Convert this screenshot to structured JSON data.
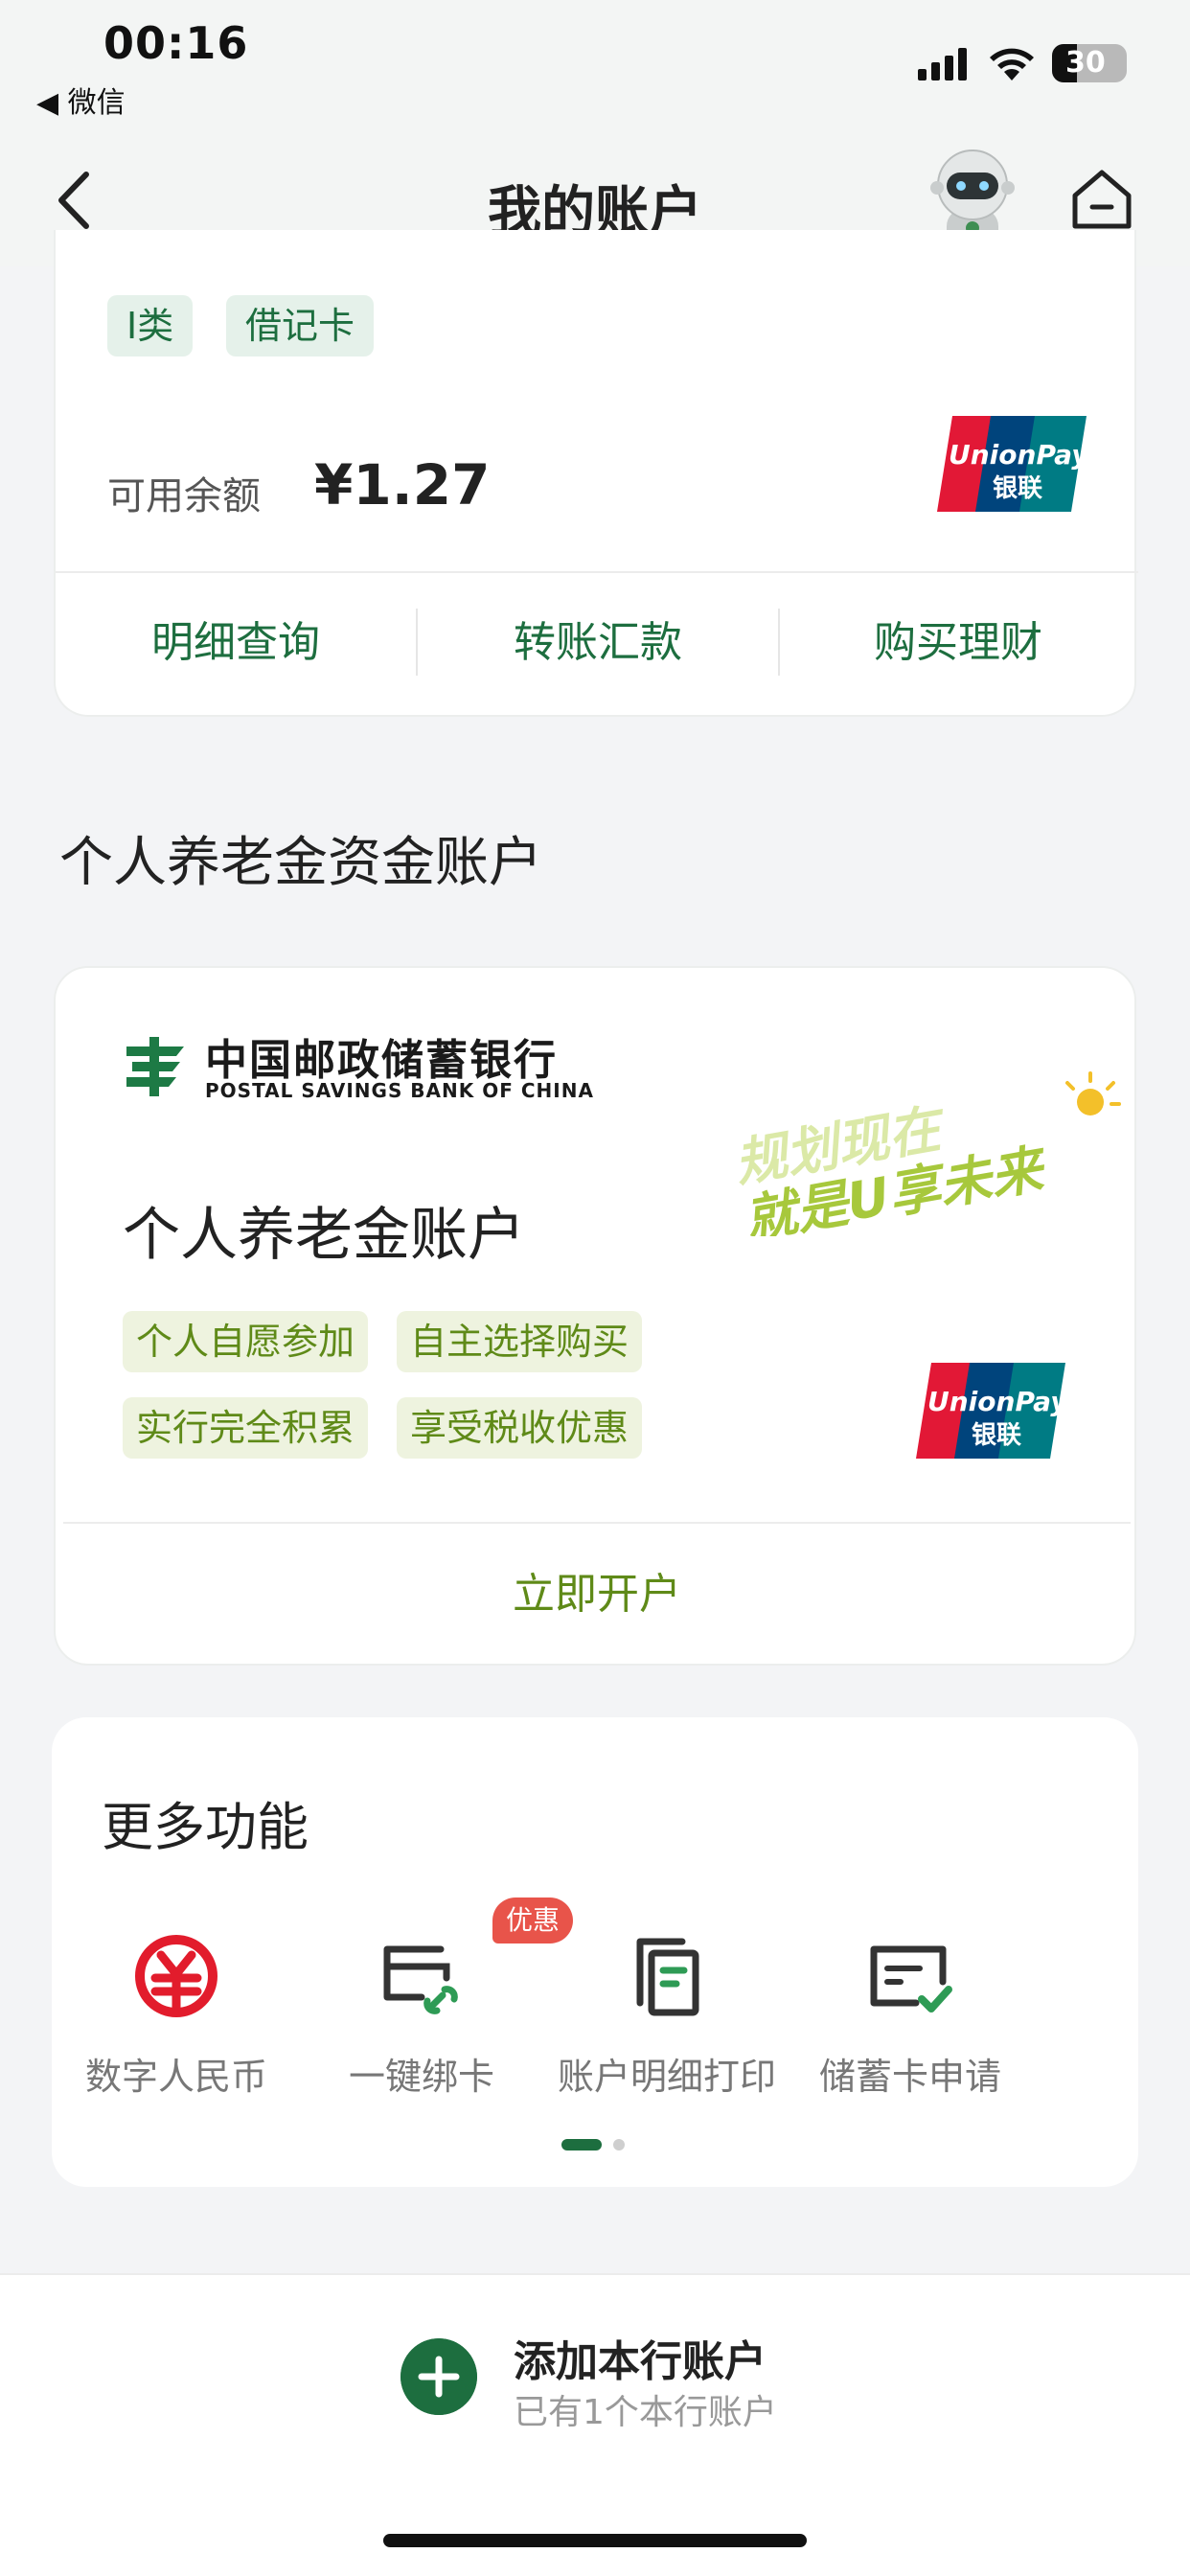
{
  "status_bar": {
    "time": "00:16",
    "back_app": "◀ 微信",
    "battery": "30"
  },
  "nav": {
    "title": "我的账户",
    "back_icon": "chevron-left-icon",
    "robot_icon": "robot-assistant-icon",
    "home_icon": "home-icon"
  },
  "account_card": {
    "tags": [
      "I类",
      "借记卡"
    ],
    "balance_label": "可用余额",
    "balance_value": "¥1.27",
    "actions": [
      "明细查询",
      "转账汇款",
      "购买理财"
    ]
  },
  "pension_section": {
    "title": "个人养老金资金账户",
    "bank_name": "中国邮政储蓄银行",
    "bank_name_en": "POSTAL SAVINGS BANK OF CHINA",
    "slogan_line1": "规划现在",
    "slogan_line2": "就是U享未来",
    "account_title": "个人养老金账户",
    "features": [
      "个人自愿参加",
      "自主选择购买",
      "实行完全积累",
      "享受税收优惠"
    ],
    "open_label": "立即开户"
  },
  "more_functions": {
    "title": "更多功能",
    "items": [
      {
        "label": "数字人民币",
        "icon": "digital-rmb-icon"
      },
      {
        "label": "一键绑卡",
        "icon": "bind-card-icon",
        "badge": "优惠"
      },
      {
        "label": "账户明细打印",
        "icon": "print-statement-icon"
      },
      {
        "label": "储蓄卡申请",
        "icon": "card-apply-icon"
      }
    ],
    "page_indicator": {
      "pages": 2,
      "current": 1
    }
  },
  "bottom": {
    "add_title": "添加本行账户",
    "add_subtitle": "已有1个本行账户"
  },
  "colors": {
    "primary_green": "#1d6e3f",
    "light_green": "#5f8a18",
    "promo_red": "#e8544a"
  }
}
